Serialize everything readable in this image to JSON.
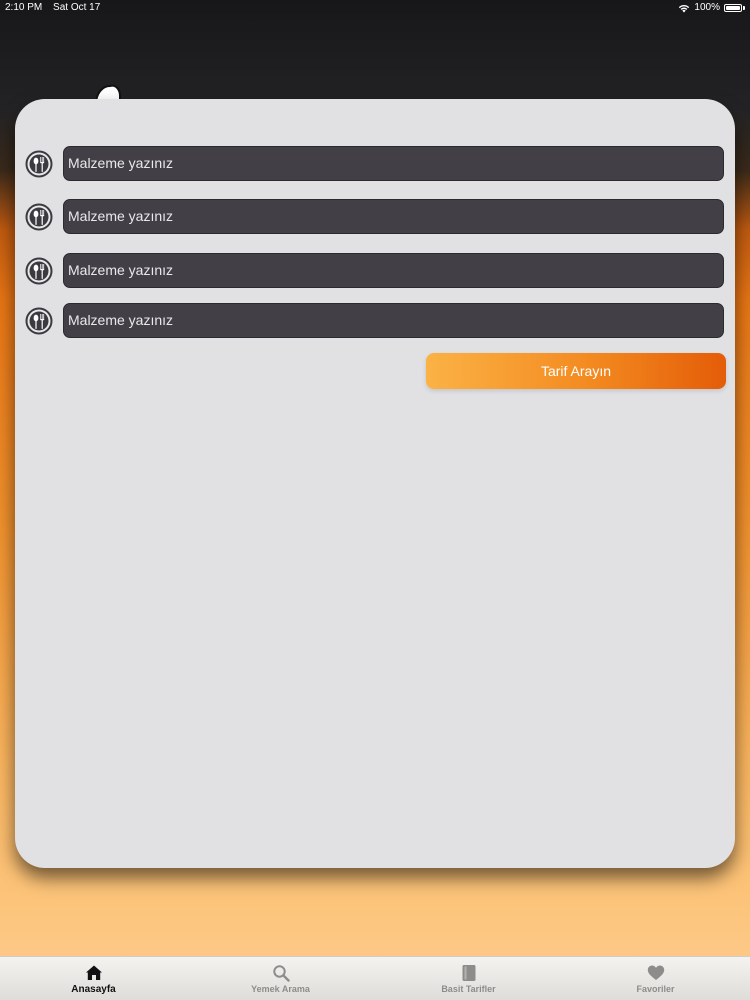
{
  "status_bar": {
    "time": "2:10 PM",
    "date": "Sat Oct 17",
    "battery": "100%"
  },
  "ingredient_inputs": [
    {
      "placeholder": "Malzeme yazınız",
      "icon": "spoon-fork-icon"
    },
    {
      "placeholder": "Malzeme yazınız",
      "icon": "spoon-fork-icon"
    },
    {
      "placeholder": "Malzeme yazınız",
      "icon": "spoon-fork-icon"
    },
    {
      "placeholder": "Malzeme yazınız",
      "icon": "spoon-fork-icon"
    }
  ],
  "search_button": {
    "label": "Tarif Arayın"
  },
  "tab_bar": {
    "tabs": [
      {
        "label": "Anasayfa",
        "icon": "home-icon",
        "active": true
      },
      {
        "label": "Yemek Arama",
        "icon": "search-icon",
        "active": false
      },
      {
        "label": "Basit Tarifler",
        "icon": "book-icon",
        "active": false
      },
      {
        "label": "Favoriler",
        "icon": "heart-icon",
        "active": false
      }
    ]
  },
  "colors": {
    "accent_start": "#fbb245",
    "accent_end": "#e45c08",
    "input_bg": "#424046",
    "card_bg": "#e1e0e3"
  }
}
